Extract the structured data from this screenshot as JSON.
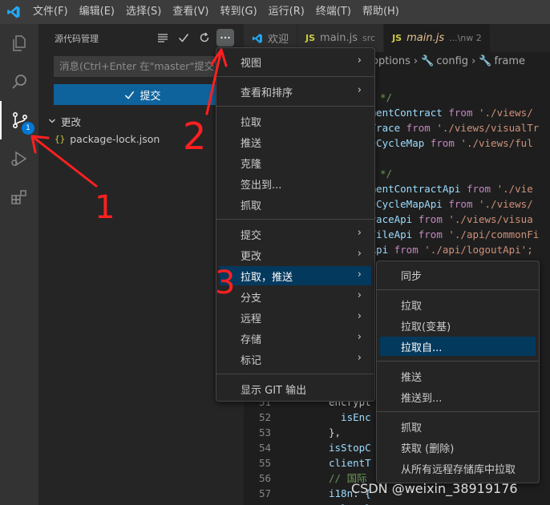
{
  "menubar": {
    "items": [
      "文件(F)",
      "编辑(E)",
      "选择(S)",
      "查看(V)",
      "转到(G)",
      "运行(R)",
      "终端(T)",
      "帮助(H)"
    ]
  },
  "activity": {
    "scm_badge": "1"
  },
  "sidebar": {
    "title": "源代码管理",
    "message_placeholder": "消息(Ctrl+Enter 在\"master\"提交)",
    "commit_label": "提交",
    "changes_label": "更改",
    "changed_file": "package-lock.json"
  },
  "tabs": [
    {
      "label": "欢迎",
      "detail": "",
      "icon": "vscode-icon"
    },
    {
      "label": "main.js",
      "detail": "src",
      "icon": "JS"
    },
    {
      "label": "main.js",
      "detail": "...\\nw 2",
      "icon": "JS"
    }
  ],
  "breadcrumb": [
    "options",
    "config",
    "frame"
  ],
  "editor": {
    "top_lines": [
      {
        "cls": "c-comment",
        "text": "块 */"
      },
      {
        "cls": "c-var",
        "text": "ementContract",
        "rest": " from ",
        "str": "'./views/"
      },
      {
        "cls": "c-var",
        "text": ".Trace",
        "rest": " from ",
        "str": "'./views/visualTr"
      },
      {
        "cls": "c-var",
        "text": "feCycleMap",
        "rest": " from ",
        "str": "'./views/ful"
      },
      {
        "cls": "c-txt",
        "text": ""
      },
      {
        "cls": "c-comment",
        "text": "定 */"
      },
      {
        "cls": "c-var",
        "text": "ementContractApi",
        "rest": " from ",
        "str": "'./vie"
      },
      {
        "cls": "c-var",
        "text": "feCycleMapApi",
        "rest": " from ",
        "str": "'./views/"
      },
      {
        "cls": "c-var",
        "text": "TraceApi",
        "rest": " from ",
        "str": "'./views/visua"
      },
      {
        "cls": "c-var",
        "text": "nFileApi",
        "rest": " from ",
        "str": "'./api/commonFi"
      },
      {
        "cls": "c-var",
        "text": "tApi",
        "rest": " from ",
        "str": "'./api/logoutApi';"
      }
    ],
    "bottom_lines": [
      {
        "num": "51",
        "text": "encrypt"
      },
      {
        "num": "52",
        "text": "  isEnc"
      },
      {
        "num": "53",
        "text": "},"
      },
      {
        "num": "54",
        "text": "isStopC"
      },
      {
        "num": "55",
        "text": "clientT"
      },
      {
        "num": "56",
        "text": "// 国际"
      },
      {
        "num": "57",
        "text": "i18n: {"
      },
      {
        "num": "58",
        "text": "  local"
      }
    ]
  },
  "context_menu": {
    "items": [
      {
        "label": "视图",
        "submenu": true
      },
      {
        "label": "查看和排序",
        "submenu": true
      },
      {
        "label": "拉取",
        "submenu": false
      },
      {
        "label": "推送",
        "submenu": false
      },
      {
        "label": "克隆",
        "submenu": false
      },
      {
        "label": "签出到...",
        "submenu": false
      },
      {
        "label": "抓取",
        "submenu": false
      },
      {
        "label": "提交",
        "submenu": true
      },
      {
        "label": "更改",
        "submenu": true
      },
      {
        "label": "拉取，推送",
        "submenu": true
      },
      {
        "label": "分支",
        "submenu": true
      },
      {
        "label": "远程",
        "submenu": true
      },
      {
        "label": "存储",
        "submenu": true
      },
      {
        "label": "标记",
        "submenu": true
      },
      {
        "label": "显示 GIT 输出",
        "submenu": false
      }
    ]
  },
  "submenu": {
    "items": [
      "同步",
      "拉取",
      "拉取(变基)",
      "拉取自...",
      "推送",
      "推送到...",
      "抓取",
      "获取 (删除)",
      "从所有远程存储库中拉取"
    ]
  },
  "annotations": {
    "mark1": "1",
    "mark2": "2",
    "mark3": "3",
    "color": "#ff2020"
  },
  "watermark": "CSDN @weixin_38919176"
}
